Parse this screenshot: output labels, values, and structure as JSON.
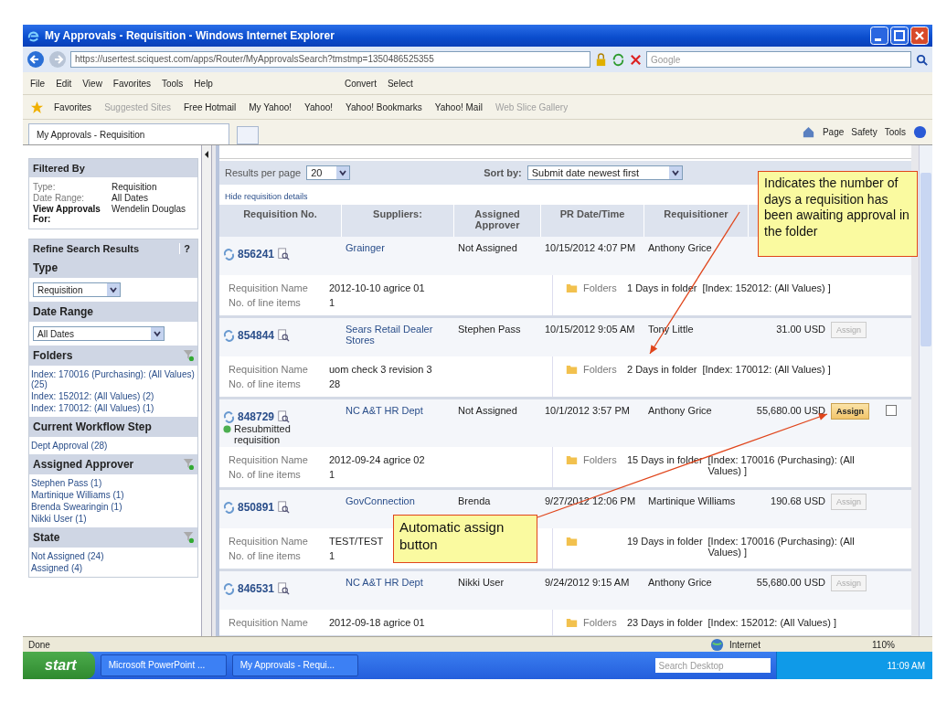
{
  "window": {
    "title": "My Approvals - Requisition - Windows Internet Explorer"
  },
  "address_bar": {
    "url": "https://usertest.sciquest.com/apps/Router/MyApprovalsSearch?tmstmp=1350486525355",
    "search_placeholder": "Google"
  },
  "menu": [
    "File",
    "Edit",
    "View",
    "Favorites",
    "Tools",
    "Help"
  ],
  "toolbar": [
    "Convert",
    "Select"
  ],
  "favorites_bar": {
    "label": "Favorites",
    "links": [
      {
        "label": "Suggested Sites",
        "disabled": true
      },
      {
        "label": "Free Hotmail",
        "disabled": false
      },
      {
        "label": "My Yahoo!",
        "disabled": false
      },
      {
        "label": "Yahoo!",
        "disabled": false
      },
      {
        "label": "Yahoo! Bookmarks",
        "disabled": false
      },
      {
        "label": "Yahoo! Mail",
        "disabled": false
      },
      {
        "label": "Web Slice Gallery",
        "disabled": true
      }
    ]
  },
  "tab": {
    "title": "My Approvals - Requisition"
  },
  "command_bar": [
    "Page",
    "Safety",
    "Tools"
  ],
  "filtered_by": {
    "title": "Filtered By",
    "rows": [
      {
        "label": "Type:",
        "value": "Requisition",
        "bold": false
      },
      {
        "label": "Date Range:",
        "value": "All Dates",
        "bold": false
      },
      {
        "label": "View Approvals For:",
        "value": "Wendelin Douglas",
        "bold": true
      }
    ]
  },
  "refine": {
    "title": "Refine Search Results",
    "help": "?",
    "sections": [
      {
        "kind": "select",
        "title": "Type",
        "value": "Requisition",
        "filter_icon": false
      },
      {
        "kind": "select",
        "title": "Date Range",
        "value": "All Dates",
        "filter_icon": false
      },
      {
        "kind": "links",
        "title": "Folders",
        "filter_icon": true,
        "items": [
          "Index: 170016 (Purchasing): (All Values) (25)",
          "Index: 152012: (All Values) (2)",
          "Index: 170012: (All Values) (1)"
        ]
      },
      {
        "kind": "links",
        "title": "Current Workflow Step",
        "filter_icon": false,
        "items": [
          "Dept Approval (28)"
        ]
      },
      {
        "kind": "links",
        "title": "Assigned Approver",
        "filter_icon": true,
        "items": [
          "Stephen Pass (1)",
          "Martinique Williams (1)",
          "Brenda Swearingin (1)",
          "Nikki User (1)"
        ]
      },
      {
        "kind": "links",
        "title": "State",
        "filter_icon": true,
        "items": [
          "Not Assigned (24)",
          "Assigned (4)"
        ]
      }
    ]
  },
  "results": {
    "per_page_label": "Results per page",
    "per_page": "20",
    "sort_label": "Sort by:",
    "sort": "Submit date newest first",
    "toggle_details": "Hide requisition details",
    "columns": [
      "Requisition No.",
      "Suppliers:",
      "Assigned Approver",
      "PR Date/Time",
      "Requisitioner"
    ],
    "rows": [
      {
        "number": "856241",
        "supplier": "Grainger",
        "approver": "Not Assigned",
        "date": "10/15/2012 4:07 PM",
        "requisitioner": "Anthony Grice",
        "name_label": "Requisition Name",
        "name": "2012-10-10 agrice 01",
        "items_label": "No. of line items",
        "items": "1",
        "folders_label": "Folders",
        "days": "1 Days in folder",
        "index": "[Index: 152012: (All Values) ]"
      },
      {
        "number": "854844",
        "supplier": "Sears Retail Dealer Stores",
        "approver": "Stephen Pass",
        "date": "10/15/2012 9:05 AM",
        "requisitioner": "Tony Little",
        "amount": "31.00 USD",
        "assign": {
          "label": "Assign",
          "disabled": true
        },
        "name_label": "Requisition Name",
        "name": "uom check 3 revision 3",
        "items_label": "No. of line items",
        "items": "28",
        "folders_label": "Folders",
        "days": "2 Days in folder",
        "index": "[Index: 170012: (All Values) ]"
      },
      {
        "number": "848729",
        "note": "Resubmitted requisition",
        "supplier": "NC A&T HR Dept",
        "approver": "Not Assigned",
        "date": "10/1/2012 3:57 PM",
        "requisitioner": "Anthony Grice",
        "amount": "55,680.00 USD",
        "assign": {
          "label": "Assign",
          "disabled": false
        },
        "checked": false,
        "name_label": "Requisition Name",
        "name": "2012-09-24 agrice 02",
        "items_label": "No. of line items",
        "items": "1",
        "folders_label": "Folders",
        "days": "15 Days in folder",
        "index": "[Index: 170016 (Purchasing): (All Values) ]"
      },
      {
        "number": "850891",
        "supplier": "GovConnection",
        "approver": "Brenda",
        "date": "9/27/2012 12:06 PM",
        "requisitioner": "Martinique Williams",
        "amount": "190.68 USD",
        "assign": {
          "label": "Assign",
          "disabled": true
        },
        "name_label": "Requisition Name",
        "name": "TEST/TEST",
        "items_label": "No. of line items",
        "items": "1",
        "days": "19 Days in folder",
        "index": "[Index: 170016 (Purchasing): (All Values) ]"
      },
      {
        "number": "846531",
        "supplier": "NC A&T HR Dept",
        "approver": "Nikki User",
        "date": "9/24/2012 9:15 AM",
        "requisitioner": "Anthony Grice",
        "amount": "55,680.00 USD",
        "assign": {
          "label": "Assign",
          "disabled": true
        },
        "name_label": "Requisition Name",
        "name": "2012-09-18 agrice 01",
        "folders_label": "Folders",
        "days": "23 Days in folder",
        "index": "[Index: 152012: (All Values) ]"
      }
    ]
  },
  "annotations": [
    {
      "text": "Indicates the number of days a requisition has been awaiting approval in the folder"
    },
    {
      "text": "Automatic assign button"
    }
  ],
  "status_bar": {
    "status": "Done",
    "zone": "Internet",
    "zoom": "110%"
  },
  "taskbar": {
    "start": "start",
    "tasks": [
      "Microsoft PowerPoint ...",
      "My Approvals - Requi..."
    ],
    "search_placeholder": "Search Desktop",
    "clock": "11:09 AM"
  }
}
